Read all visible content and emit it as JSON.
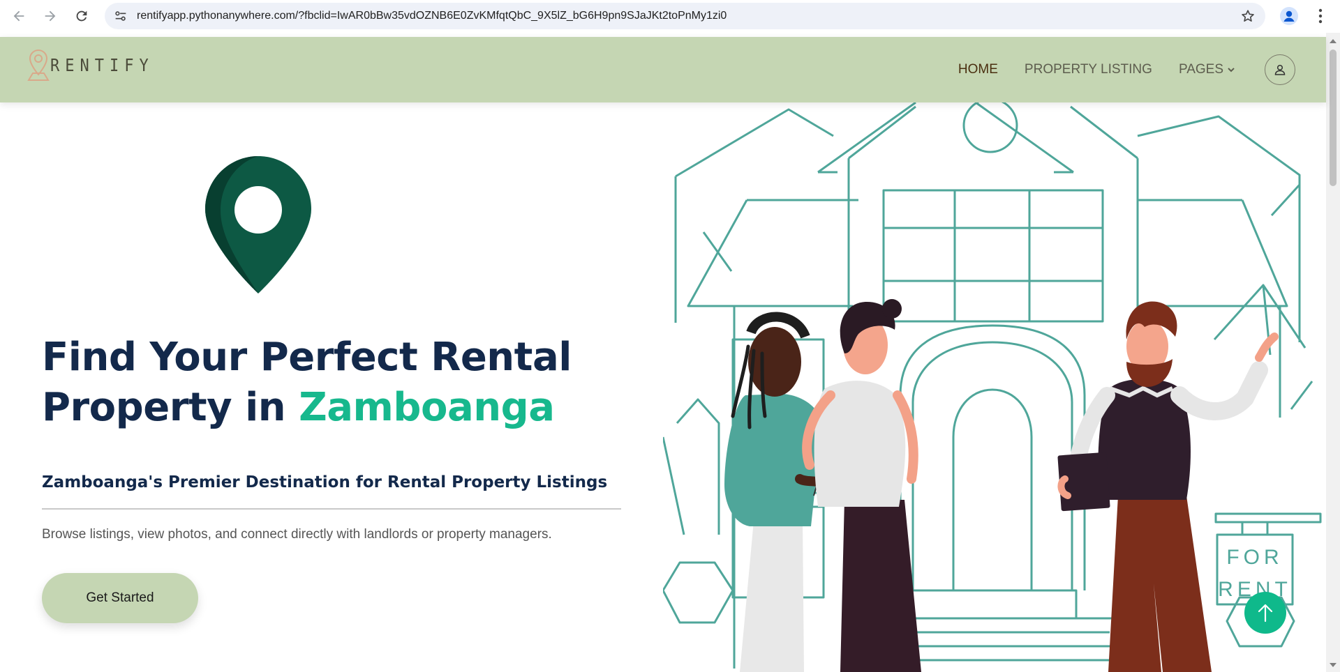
{
  "browser": {
    "url": "rentifyapp.pythonanywhere.com/?fbclid=IwAR0bBw35vdOZNB6E0ZvKMfqtQbC_9X5lZ_bG6H9pn9SJaJKt2toPnMy1zi0",
    "icons": [
      "back-arrow-icon",
      "forward-arrow-icon",
      "reload-icon",
      "site-info-icon",
      "bookmark-star-icon",
      "profile-icon",
      "more-vert-icon"
    ]
  },
  "header": {
    "brand": "RENTIFY",
    "menu": [
      {
        "label": "HOME",
        "active": true
      },
      {
        "label": "PROPERTY LISTING",
        "active": false
      },
      {
        "label": "PAGES",
        "active": false,
        "has_dropdown": true
      }
    ],
    "bg_color": "#c5d6b3"
  },
  "hero": {
    "title_line1": "Find Your Perfect Rental",
    "title_line2_prefix": "Property in ",
    "title_accent": "Zamboanga",
    "subtitle": "Zamboanga's Premier Destination for Rental Property Listings",
    "description": "Browse listings, view photos, and connect directly with landlords or property managers.",
    "cta_label": "Get Started",
    "sign_line1": "FOR",
    "sign_line2": "RENT",
    "title_color": "#13294b",
    "accent_color": "#17b88d",
    "illustration_line_color": "#4fa69a"
  }
}
